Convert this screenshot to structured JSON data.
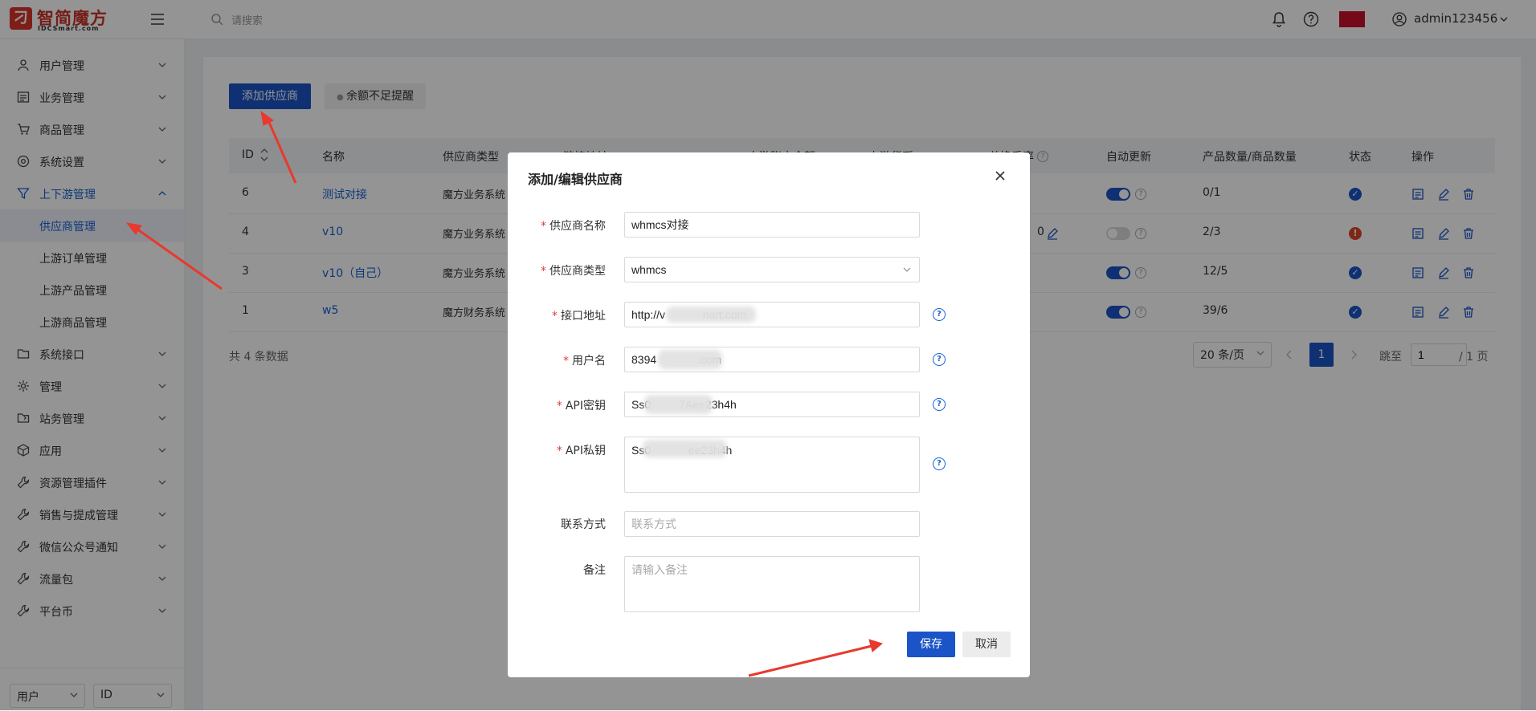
{
  "brand": {
    "name": "智简魔方",
    "subtitle": "IDCSmart.com"
  },
  "search": {
    "placeholder": "请搜索"
  },
  "user": {
    "name": "admin123456"
  },
  "sidebar": {
    "items": [
      {
        "label": "用户管理",
        "icon": "user-icon"
      },
      {
        "label": "业务管理",
        "icon": "list-icon"
      },
      {
        "label": "商品管理",
        "icon": "cart-icon"
      },
      {
        "label": "系统设置",
        "icon": "gear-icon"
      },
      {
        "label": "上下游管理",
        "icon": "filter-icon"
      },
      {
        "label": "系统接口",
        "icon": "folder-icon"
      },
      {
        "label": "管理",
        "icon": "sun-icon"
      },
      {
        "label": "站务管理",
        "icon": "folder-share-icon"
      },
      {
        "label": "应用",
        "icon": "cube-icon"
      },
      {
        "label": "资源管理插件",
        "icon": "wrench-icon"
      },
      {
        "label": "销售与提成管理",
        "icon": "wrench-icon"
      },
      {
        "label": "微信公众号通知",
        "icon": "wrench-icon"
      },
      {
        "label": "流量包",
        "icon": "wrench-icon"
      },
      {
        "label": "平台币",
        "icon": "wrench-icon"
      }
    ],
    "sub_items": [
      {
        "label": "供应商管理"
      },
      {
        "label": "上游订单管理"
      },
      {
        "label": "上游产品管理"
      },
      {
        "label": "上游商品管理"
      }
    ],
    "bottom": {
      "select1": "用户",
      "select2": "ID"
    }
  },
  "toolbar": {
    "add_label": "添加供应商",
    "balance_label": "余额不足提醒"
  },
  "table": {
    "headers": [
      "ID",
      "名称",
      "供应商类型",
      "链接地址",
      "上游账户余额",
      "上游货币",
      "总换手率",
      "自动更新",
      "产品数量/商品数量",
      "状态",
      "操作"
    ],
    "rows": [
      {
        "id": "6",
        "name": "测试对接",
        "type": "魔方业务系统",
        "balance_tail": "",
        "auto": true,
        "count": "0/1",
        "status": "ok"
      },
      {
        "id": "4",
        "name": "v10",
        "type": "魔方业务系统",
        "balance_tail": "0",
        "auto": false,
        "count": "2/3",
        "status": "error"
      },
      {
        "id": "3",
        "name": "v10（自己）",
        "type": "魔方业务系统",
        "balance_tail": "",
        "auto": true,
        "count": "12/5",
        "status": "ok"
      },
      {
        "id": "1",
        "name": "w5",
        "type": "魔方财务系统",
        "balance_tail": "",
        "auto": true,
        "count": "39/6",
        "status": "ok"
      }
    ],
    "total": "共 4 条数据",
    "page_size": "20 条/页",
    "current_page": "1",
    "jump_label": "跳至",
    "jump_value": "1",
    "page_total": "/ 1 页"
  },
  "modal": {
    "title": "添加/编辑供应商",
    "fields": {
      "name": {
        "label": "供应商名称",
        "value": "whmcs对接"
      },
      "type": {
        "label": "供应商类型",
        "value": "whmcs"
      },
      "url": {
        "label": "接口地址",
        "value": "http://v            nart.com"
      },
      "username": {
        "label": "用户名",
        "value": "8394             .com"
      },
      "api_key": {
        "label": "API密钥",
        "value": "Ss0         7Aee23h4h"
      },
      "api_secret": {
        "label": "API私钥",
        "value": "Ss0            ee23h4h"
      },
      "contact": {
        "label": "联系方式",
        "placeholder": "联系方式"
      },
      "note": {
        "label": "备注",
        "placeholder": "请输入备注"
      }
    },
    "save_label": "保存",
    "cancel_label": "取消"
  },
  "colors": {
    "primary": "#1a54c6",
    "brand_red": "#c8332a",
    "annotation_arrow": "#e8392e",
    "success": "#1a54c6",
    "error": "#d9462b"
  }
}
